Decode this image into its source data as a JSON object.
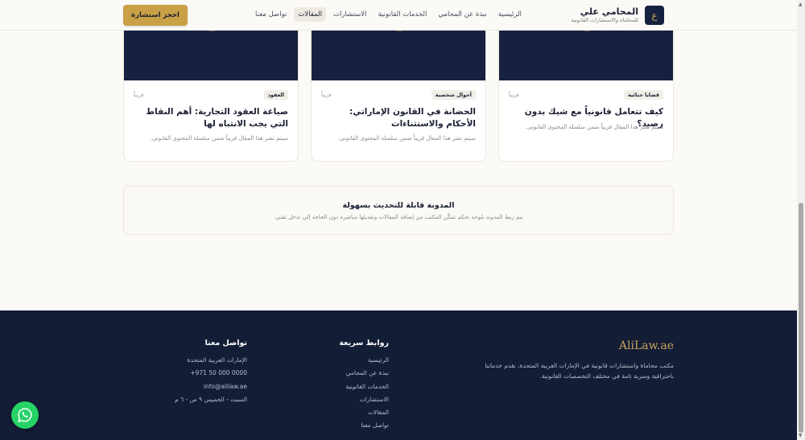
{
  "header": {
    "brand_name": "المحامي علي",
    "brand_sub": "للمحاماة والاستشارات القانونية",
    "logo_letter": "ع",
    "nav": [
      {
        "label": "الرئيسية",
        "active": false
      },
      {
        "label": "نبذة عن المحامي",
        "active": false
      },
      {
        "label": "الخدمات القانونية",
        "active": false
      },
      {
        "label": "الاستشارات",
        "active": false
      },
      {
        "label": "المقالات",
        "active": true
      },
      {
        "label": "تواصل معنا",
        "active": false
      }
    ],
    "cta_label": "احجز استشارة"
  },
  "articles": [
    {
      "tag": "قضايا جنائية",
      "soon": "قريباً",
      "title": "كيف تتعامل قانونياً مع شيك بدون رصيد؟",
      "desc": "سيتم نشر هذا المقال قريباً ضمن سلسلة المحتوى القانوني."
    },
    {
      "tag": "أحوال شخصية",
      "soon": "قريباً",
      "title": "الحضانة في القانون الإماراتي: الأحكام والاستثناءات",
      "desc": "سيتم نشر هذا المقال قريباً ضمن سلسلة المحتوى القانوني."
    },
    {
      "tag": "العقود",
      "soon": "قريباً",
      "title": "صياغة العقود التجارية: أهم النقاط التي يجب الانتباه لها",
      "desc": "سيتم نشر هذا المقال قريباً ضمن سلسلة المحتوى القانوني."
    }
  ],
  "notice": {
    "title": "المدونة قابلة للتحديث بسهولة",
    "text": "يتم ربط المدونة بلوحة تحكم تمكّن المكتب من إضافة المقالات وتعديلها مباشرة دون الحاجة إلى تدخل تقني."
  },
  "footer": {
    "logo": "AliLaw.ae",
    "about": "مكتب محاماة واستشارات قانونية في الإمارات العربية المتحدة، نقدم خدماتنا باحترافية وسرية تامة في مختلف التخصصات القانونية.",
    "quick_links_title": "روابط سريعة",
    "quick_links": [
      "الرئيسية",
      "نبذة عن المحامي",
      "الخدمات القانونية",
      "الاستشارات",
      "المقالات",
      "تواصل معنا"
    ],
    "contact_title": "تواصل معنا",
    "contact": [
      "الإمارات العربية المتحدة",
      "+971 50 000 0000",
      "info@alilaw.ae",
      "السبت - الخميس ٩ ص - ٦ م"
    ]
  },
  "colors": {
    "navy": "#141d36",
    "gold": "#c9a045",
    "whatsapp": "#25d366"
  },
  "icons": {
    "whatsapp": "whatsapp-icon"
  }
}
